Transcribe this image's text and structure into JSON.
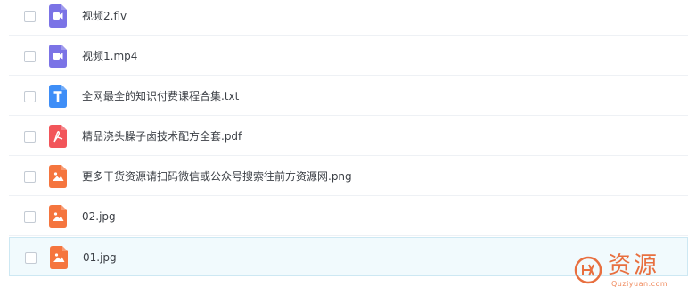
{
  "files": [
    {
      "name": "视频2.flv",
      "type": "video-icon",
      "color": "#7b73e6",
      "selected": false
    },
    {
      "name": "视频1.mp4",
      "type": "video-icon",
      "color": "#7b73e6",
      "selected": false
    },
    {
      "name": "全网最全的知识付费课程合集.txt",
      "type": "text-file-icon",
      "color": "#3e8ef7",
      "selected": false
    },
    {
      "name": "精品浇头臊子卤技术配方全套.pdf",
      "type": "pdf-icon",
      "color": "#f2555a",
      "selected": false
    },
    {
      "name": "更多干货资源请扫码微信或公众号搜索往前方资源网.png",
      "type": "image-icon",
      "color": "#f5753e",
      "selected": false
    },
    {
      "name": "02.jpg",
      "type": "image-icon",
      "color": "#f5753e",
      "selected": false
    },
    {
      "name": "01.jpg",
      "type": "image-icon",
      "color": "#f5753e",
      "selected": true
    }
  ],
  "watermark": {
    "title": "资源",
    "subtitle": "Quziyuan.com",
    "color": "#e86f3f"
  }
}
